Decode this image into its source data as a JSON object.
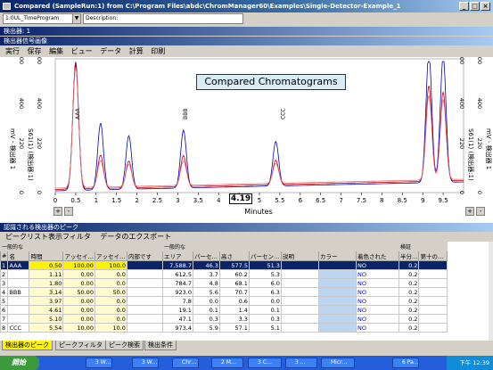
{
  "window": {
    "title": "Compared (SampleRun:1) from C:\\Program Files\\abdc\\ChromManager60\\Examples\\Single-Detector-Example_1",
    "minimize": "_",
    "maximize": "□",
    "close": "×"
  },
  "toolbar": {
    "method_value": "1:0UL_TimeProgram",
    "description_value": "Description:"
  },
  "panel_detector": "検出器: 1",
  "panel_signal": "検出器信号画像",
  "menu": [
    "実行",
    "保存",
    "編集",
    "ビュー",
    "データ",
    "計算",
    "印刷"
  ],
  "chart": {
    "title": "Compared Chromatograms",
    "cursor_value": "4.19",
    "left_axis_labels": [
      "mV - 検出器 1",
      "S61(1) (検出器:1)"
    ],
    "right_axis_labels": [
      "S61(1) (検出器:1)",
      "mV - 検出器 1"
    ],
    "peak_labels": [
      "AAA",
      "BBB",
      "CCC"
    ],
    "zoom_in": "+",
    "zoom_out": "-"
  },
  "chart_data": {
    "type": "line",
    "xlabel": "Minutes",
    "xlim": [
      0,
      10
    ],
    "ylim": [
      0,
      600
    ],
    "x_ticks": [
      "0",
      "0.5",
      "1",
      "1.5",
      "2",
      "2.5",
      "3",
      "3.5",
      "4",
      "4.5",
      "5",
      "5.5",
      "6",
      "6.5",
      "7",
      "7.5",
      "8",
      "8.5",
      "9",
      "9.5"
    ],
    "y_ticks_left": [
      "600",
      "400",
      "220",
      "0"
    ],
    "y_ticks_right": [
      "600",
      "400",
      "220",
      "0"
    ],
    "series": [
      {
        "color": "#0000cc",
        "peaks": [
          [
            0.5,
            577
          ],
          [
            1.11,
            300
          ],
          [
            1.8,
            240
          ],
          [
            3.14,
            260
          ],
          [
            5.4,
            200
          ],
          [
            9.15,
            585
          ],
          [
            9.5,
            570
          ]
        ]
      },
      {
        "color": "#cc0000",
        "peaks": [
          [
            0.5,
            560
          ],
          [
            1.11,
            150
          ],
          [
            1.8,
            120
          ],
          [
            3.14,
            140
          ],
          [
            5.4,
            110
          ],
          [
            9.15,
            430
          ],
          [
            9.5,
            400
          ]
        ]
      },
      {
        "color": "#e07070",
        "peaks": [
          [
            0.5,
            540
          ],
          [
            1.11,
            120
          ],
          [
            1.8,
            100
          ],
          [
            3.14,
            110
          ],
          [
            5.4,
            90
          ],
          [
            9.15,
            380
          ],
          [
            9.5,
            360
          ]
        ]
      }
    ]
  },
  "peaks_section": {
    "title": "認識される検出器のピーク",
    "toolbar_items": [
      "ピークリスト表示フィルタ",
      "データのエクスポート"
    ]
  },
  "grid": {
    "group_headers": {
      "general": "一般的な",
      "general2": "一般的な",
      "detect": "検証"
    },
    "columns": [
      "#",
      "名",
      "時間",
      "アッセイ…",
      "アッセイ…",
      "内部です",
      "エリア",
      "パーセ…",
      "高さ",
      "パーセン…",
      "説明",
      "カラー",
      "着色された",
      "半分…",
      "第十の…"
    ],
    "rows": [
      {
        "n": "1",
        "name": "AAA",
        "time": "0.50",
        "a1": "100.00",
        "a2": "100.0",
        "int": "",
        "area": "7,588.7",
        "pct": "46.3",
        "height": "577.5",
        "hpct": "51.3",
        "desc": "",
        "colored": "NO",
        "half": "0.2"
      },
      {
        "n": "2",
        "name": "",
        "time": "1.11",
        "a1": "0.00",
        "a2": "0.0",
        "int": "",
        "area": "612.5",
        "pct": "3.7",
        "height": "60.2",
        "hpct": "5.3",
        "desc": "",
        "colored": "NO",
        "half": "0.2"
      },
      {
        "n": "3",
        "name": "",
        "time": "1.80",
        "a1": "0.00",
        "a2": "0.0",
        "int": "",
        "area": "784.7",
        "pct": "4.8",
        "height": "68.1",
        "hpct": "6.0",
        "desc": "",
        "colored": "NO",
        "half": "0.2"
      },
      {
        "n": "4",
        "name": "BBB",
        "time": "3.14",
        "a1": "50.00",
        "a2": "50.0",
        "int": "",
        "area": "923.0",
        "pct": "5.6",
        "height": "70.7",
        "hpct": "6.3",
        "desc": "",
        "colored": "NO",
        "half": "0.2"
      },
      {
        "n": "5",
        "name": "",
        "time": "3.97",
        "a1": "0.00",
        "a2": "0.0",
        "int": "",
        "area": "7.8",
        "pct": "0.0",
        "height": "0.6",
        "hpct": "0.0",
        "desc": "",
        "colored": "NO",
        "half": "0.2"
      },
      {
        "n": "6",
        "name": "",
        "time": "4.61",
        "a1": "0.00",
        "a2": "0.0",
        "int": "",
        "area": "19.1",
        "pct": "0.1",
        "height": "1.4",
        "hpct": "0.1",
        "desc": "",
        "colored": "NO",
        "half": "0.2"
      },
      {
        "n": "7",
        "name": "",
        "time": "5.10",
        "a1": "0.00",
        "a2": "0.0",
        "int": "",
        "area": "47.1",
        "pct": "0.3",
        "height": "3.3",
        "hpct": "0.3",
        "desc": "",
        "colored": "NO",
        "half": "0.2"
      },
      {
        "n": "8",
        "name": "CCC",
        "time": "5.54",
        "a1": "10.00",
        "a2": "10.0",
        "int": "",
        "area": "973.4",
        "pct": "5.9",
        "height": "57.1",
        "hpct": "5.1",
        "desc": "",
        "colored": "NO",
        "half": "0.2"
      }
    ]
  },
  "bottom_tabs": [
    "検出器のピーク",
    "ピークフィルタ",
    "ピーク検索",
    "検出条件"
  ],
  "taskbar": {
    "start": "開始",
    "items": [
      "3 W…",
      "3 W…",
      "Chr…",
      "2 M…",
      "3 C…",
      "3 …",
      "Micr…",
      "6 Pa…"
    ],
    "clock": "下午 12:39"
  }
}
